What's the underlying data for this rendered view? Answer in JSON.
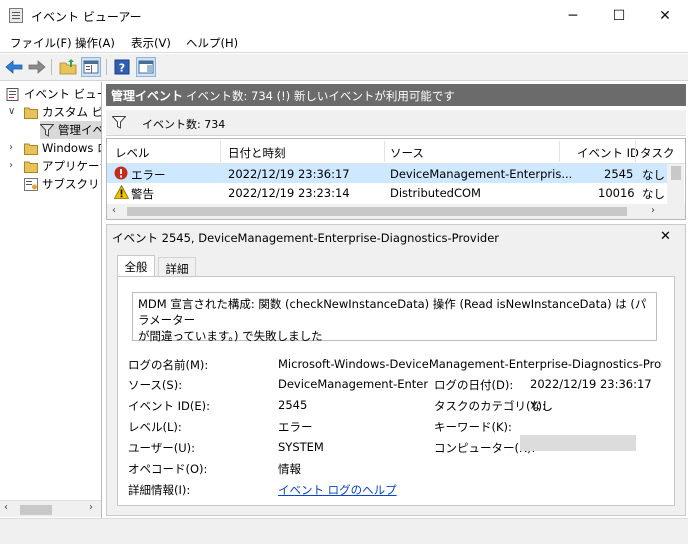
{
  "window": {
    "title": "イベント ビューアー",
    "min": "─",
    "max": "☐",
    "close": "✕"
  },
  "menu": [
    "ファイル(F)",
    "操作(A)",
    "表示(V)",
    "ヘルプ(H)"
  ],
  "tree": {
    "root": "イベント ビューアー",
    "custom": "カスタム ビュー",
    "admin": "管理イベント",
    "windows": "Windows ログ",
    "apps": "アプリケーションとサービス ログ",
    "subs": "サブスクリプション"
  },
  "header": {
    "title": "管理イベント",
    "info": "イベント数: 734 (!) 新しいイベントが利用可能です"
  },
  "filter": {
    "count": "イベント数: 734"
  },
  "table": {
    "columns": [
      "レベル",
      "日付と時刻",
      "ソース",
      "イベント ID",
      "タスク"
    ],
    "rows": [
      {
        "level": "エラー",
        "datetime": "2022/12/19 23:36:17",
        "source": "DeviceManagement-Enterpris...",
        "id": "2545",
        "task": "なし"
      },
      {
        "level": "警告",
        "datetime": "2022/12/19 23:23:14",
        "source": "DistributedCOM",
        "id": "10016",
        "task": "なし"
      }
    ]
  },
  "detail": {
    "title": "イベント 2545, DeviceManagement-Enterprise-Diagnostics-Provider",
    "close": "✕",
    "tabs": [
      "全般",
      "詳細"
    ],
    "message_line1": "MDM 宣言された構成: 関数 (checkNewInstanceData) 操作 (Read isNewInstanceData) は (パラメーター",
    "message_line2": "が間違っています。) で失敗しました",
    "fields": {
      "log_name_label": "ログの名前(M):",
      "log_name": "Microsoft-Windows-DeviceManagement-Enterprise-Diagnostics-Provider/Admin",
      "source_label": "ソース(S):",
      "source": "DeviceManagement-Enterpris",
      "date_label": "ログの日付(D):",
      "date": "2022/12/19 23:36:17",
      "eventid_label": "イベント ID(E):",
      "eventid": "2545",
      "category_label": "タスクのカテゴリ(Y):",
      "category": "なし",
      "level_label": "レベル(L):",
      "level": "エラー",
      "keywords_label": "キーワード(K):",
      "user_label": "ユーザー(U):",
      "user": "SYSTEM",
      "computer_label": "コンピューター(R):",
      "opcode_label": "オペコード(O):",
      "opcode": "情報",
      "moreinfo_label": "詳細情報(I):",
      "moreinfo_link": "イベント ログのヘルプ"
    }
  },
  "colors": {
    "header_bg": "#6b6b6b",
    "selection": "#cde8ff",
    "link": "#0645c8",
    "error_icon": "#c42b1c",
    "warning_icon": "#f2c200"
  }
}
